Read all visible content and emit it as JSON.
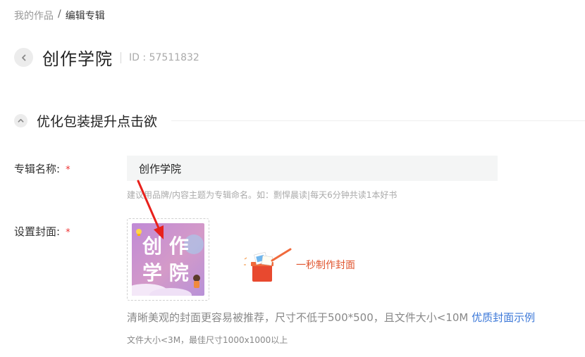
{
  "breadcrumb": {
    "parent": "我的作品",
    "separator": "/",
    "current": "编辑专辑"
  },
  "header": {
    "title": "创作学院",
    "id_text": "ID : 57511832"
  },
  "section": {
    "title": "优化包装提升点击欲"
  },
  "form": {
    "name_label": "专辑名称:",
    "name_value": "创作学院",
    "name_hint": "建议用品牌/内容主题为专辑命名。如：剽悍晨读|每天6分钟共读1本好书",
    "cover_label": "设置封面:",
    "required_mark": "*",
    "cover_image_text": [
      "创 作",
      "学 院"
    ],
    "make_cover_label": "一秒制作封面",
    "cover_tip": "清晰美观的封面更容易被推荐，尺寸不低于500*500，且文件大小<10M",
    "cover_tip_link": "优质封面示例",
    "file_tip": "文件大小<3M，最佳尺寸1000x1000以上"
  },
  "colors": {
    "required": "#ee3333",
    "link": "#3c78d8",
    "accent": "#e0552f",
    "annotation_arrow": "#e8211c"
  }
}
